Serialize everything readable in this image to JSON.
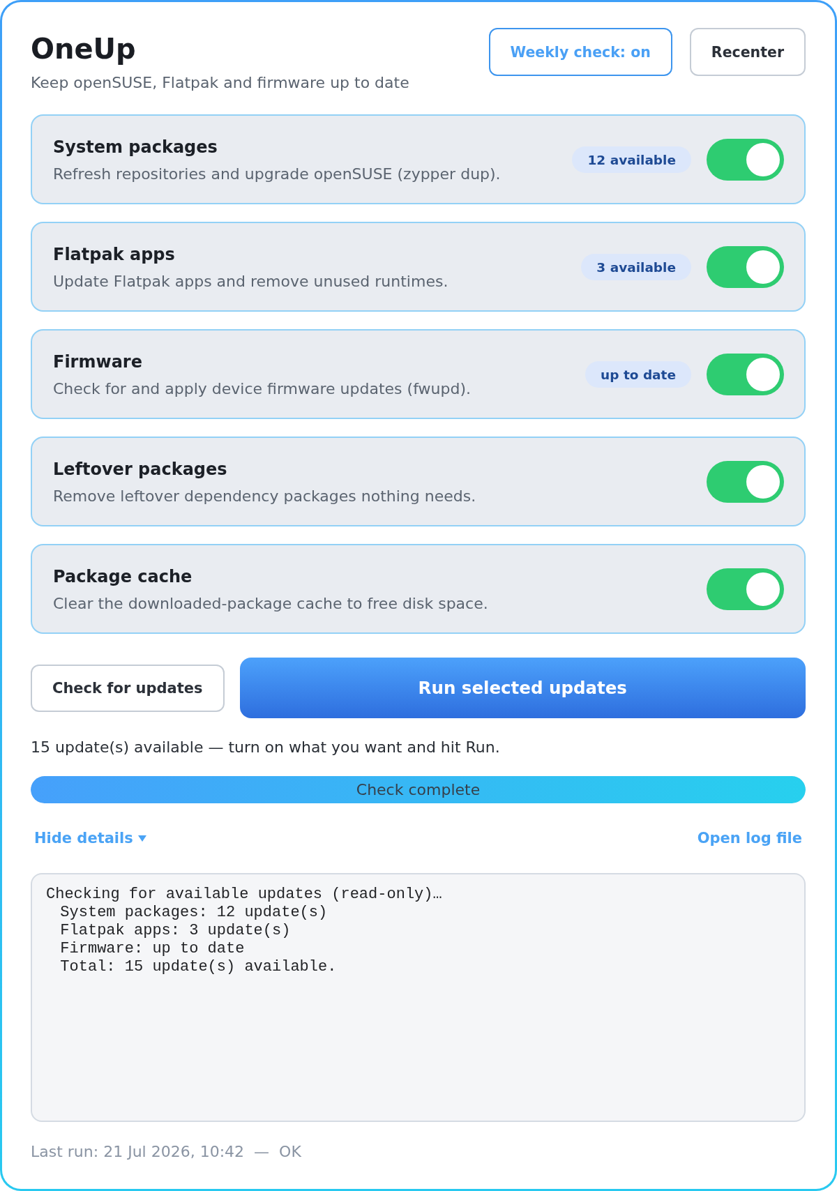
{
  "app": {
    "title": "OneUp",
    "subtitle": "Keep openSUSE, Flatpak and firmware up to date"
  },
  "weekly_check": {
    "label": "Weekly check: on",
    "on": true
  },
  "recenter_button": {
    "label": "Recenter"
  },
  "tasks": [
    {
      "title": "System packages",
      "description": "Refresh repositories and upgrade openSUSE (zypper dup).",
      "badge": "12 available",
      "enabled": true
    },
    {
      "title": "Flatpak apps",
      "description": "Update Flatpak apps and remove unused runtimes.",
      "badge": "3 available",
      "enabled": true
    },
    {
      "title": "Firmware",
      "description": "Check for and apply device firmware updates (fwupd).",
      "badge": "up to date",
      "enabled": true
    },
    {
      "title": "Leftover packages",
      "description": "Remove leftover dependency packages nothing needs.",
      "enabled": true
    },
    {
      "title": "Package cache",
      "description": "Clear the downloaded-package cache to free disk space.",
      "enabled": true
    }
  ],
  "actions": {
    "check": "Check for updates",
    "run": "Run selected updates"
  },
  "status": "15 update(s) available — turn on what you want and hit Run.",
  "progress": {
    "level": 1,
    "label": "Check complete"
  },
  "details": {
    "label": "Hide details",
    "expanded": true,
    "open_log": "Open log file"
  },
  "log": {
    "lines": [
      {
        "text": "Checking for available updates (read-only)…",
        "children": [
          {
            "text": "System packages: 12 update(s)"
          },
          {
            "text": "Flatpak apps: 3 update(s)"
          },
          {
            "text": "Firmware: up to date"
          },
          {
            "text": "Total: 15 update(s) available."
          }
        ]
      }
    ]
  },
  "footer": {
    "last_run": "Last run: 21 Jul 2026, 10:42",
    "separator": "—",
    "result": "OK"
  }
}
